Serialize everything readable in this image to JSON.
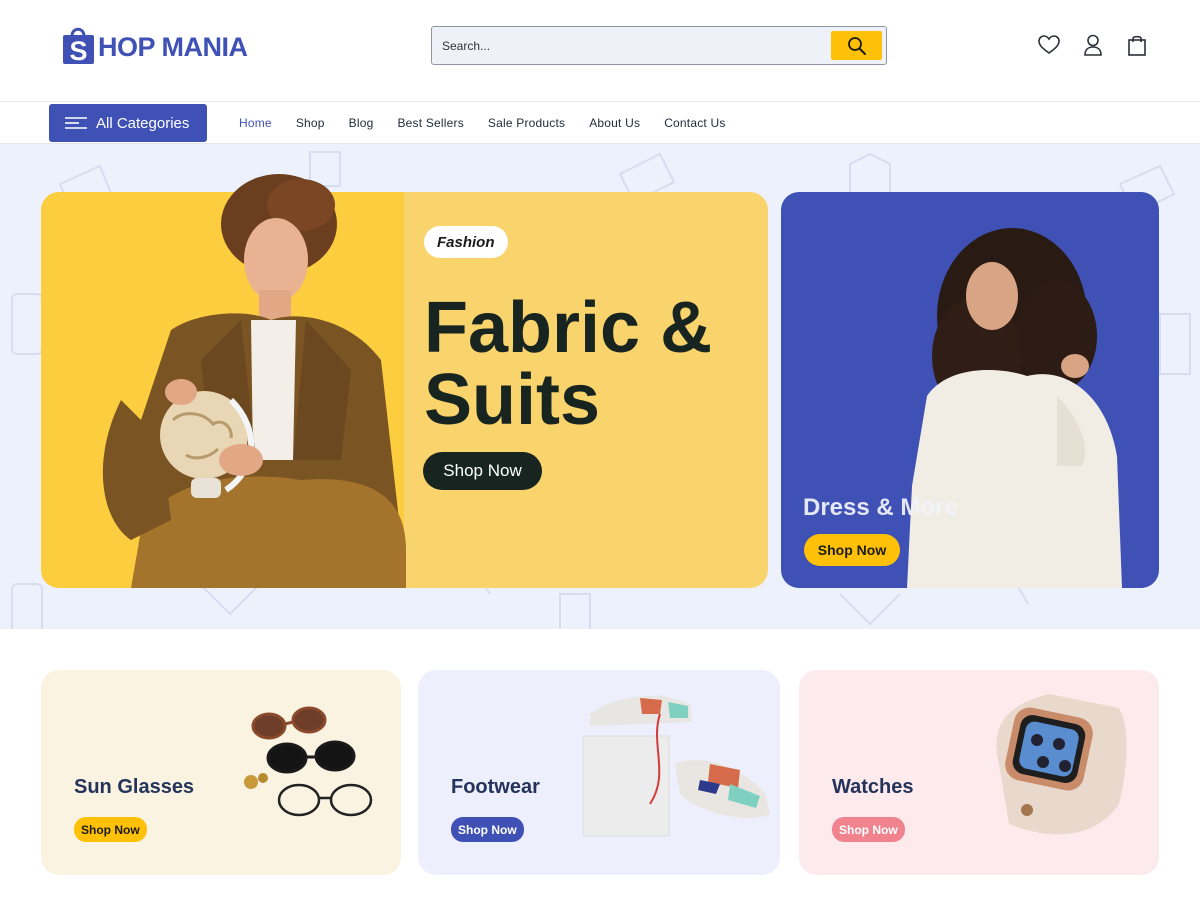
{
  "header": {
    "logo_text": "HOP MANIA",
    "search": {
      "placeholder": "Search...",
      "button_icon": "search-icon"
    },
    "icons": [
      "heart-icon",
      "user-icon",
      "cart-icon"
    ]
  },
  "nav": {
    "all_categories_label": "All Categories",
    "items": [
      {
        "label": "Home",
        "active": true
      },
      {
        "label": "Shop"
      },
      {
        "label": "Blog"
      },
      {
        "label": "Best Sellers"
      },
      {
        "label": "Sale Products"
      },
      {
        "label": "About Us"
      },
      {
        "label": "Contact Us"
      }
    ]
  },
  "hero": {
    "main": {
      "tag": "Fashion",
      "title_line1": "Fabric &",
      "title_line2": "Suits",
      "button": "Shop Now"
    },
    "side": {
      "title": "Dress & More",
      "button": "Shop Now"
    }
  },
  "categories": [
    {
      "title": "Sun Glasses",
      "button": "Shop Now"
    },
    {
      "title": "Footwear",
      "button": "Shop Now"
    },
    {
      "title": "Watches",
      "button": "Shop Now"
    }
  ],
  "colors": {
    "brand": "#3f51b5",
    "accent": "#ffc107",
    "dark": "#172420"
  }
}
